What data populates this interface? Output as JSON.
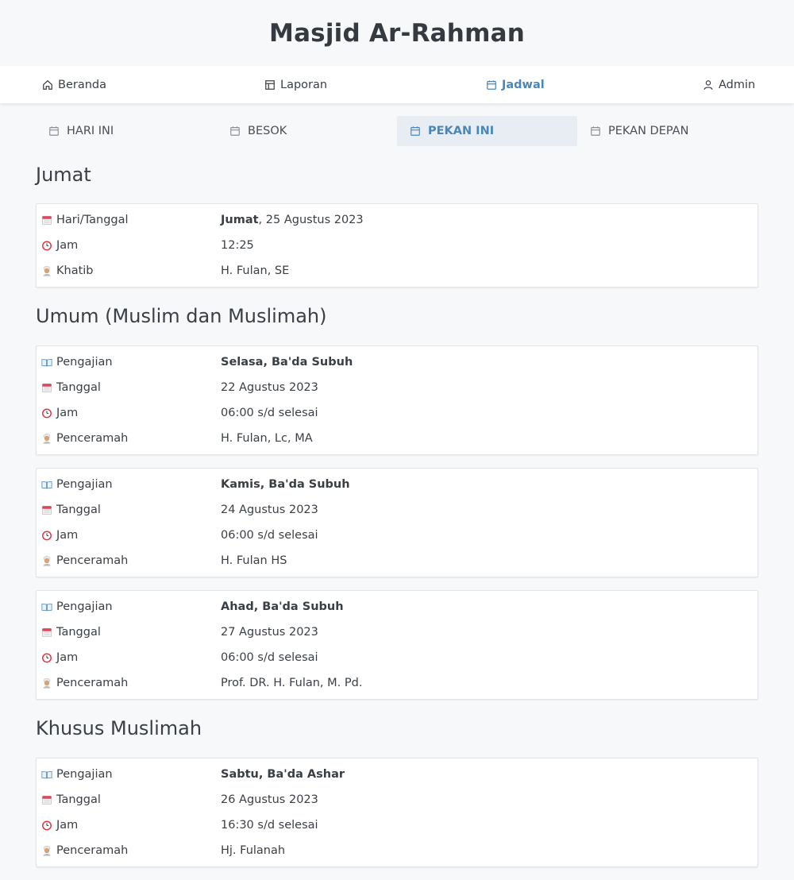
{
  "app": {
    "title": "Masjid Ar-Rahman"
  },
  "nav": {
    "items": [
      {
        "label": "Beranda",
        "icon": "home-icon"
      },
      {
        "label": "Laporan",
        "icon": "table-icon"
      },
      {
        "label": "Jadwal",
        "icon": "calendar-icon",
        "active": true
      },
      {
        "label": "Admin",
        "icon": "user-icon"
      }
    ]
  },
  "tabs": [
    {
      "label": "HARI INI",
      "icon": "calendar-icon"
    },
    {
      "label": "BESOK",
      "icon": "calendar-icon"
    },
    {
      "label": "PEKAN INI",
      "icon": "calendar-icon",
      "active": true
    },
    {
      "label": "PEKAN DEPAN",
      "icon": "calendar-icon"
    }
  ],
  "colors": {
    "accent": "#4a86b8",
    "active_tab_bg": "#e8edf4",
    "page_bg": "#f7f8fa"
  },
  "sections": {
    "jumat": {
      "title": "Jumat",
      "card": {
        "hari_label": "Hari/Tanggal",
        "hari_day": "Jumat",
        "hari_date": ", 25 Agustus 2023",
        "jam_label": "Jam",
        "jam_value": "12:25",
        "khatib_label": "Khatib",
        "khatib_value": "H. Fulan, SE"
      }
    },
    "umum": {
      "title": "Umum (Muslim dan Muslimah)",
      "cards": [
        {
          "pengajian_label": "Pengajian",
          "pengajian_value": "Selasa, Ba'da Subuh",
          "tanggal_label": "Tanggal",
          "tanggal_value": "22 Agustus 2023",
          "jam_label": "Jam",
          "jam_value": "06:00 s/d selesai",
          "penceramah_label": "Penceramah",
          "penceramah_value": "H. Fulan, Lc, MA"
        },
        {
          "pengajian_label": "Pengajian",
          "pengajian_value": "Kamis, Ba'da Subuh",
          "tanggal_label": "Tanggal",
          "tanggal_value": "24 Agustus 2023",
          "jam_label": "Jam",
          "jam_value": "06:00 s/d selesai",
          "penceramah_label": "Penceramah",
          "penceramah_value": "H. Fulan HS"
        },
        {
          "pengajian_label": "Pengajian",
          "pengajian_value": "Ahad, Ba'da Subuh",
          "tanggal_label": "Tanggal",
          "tanggal_value": "27 Agustus 2023",
          "jam_label": "Jam",
          "jam_value": "06:00 s/d selesai",
          "penceramah_label": "Penceramah",
          "penceramah_value": "Prof. DR. H. Fulan, M. Pd."
        }
      ]
    },
    "muslimah": {
      "title": "Khusus Muslimah",
      "cards": [
        {
          "pengajian_label": "Pengajian",
          "pengajian_value": "Sabtu, Ba'da Ashar",
          "tanggal_label": "Tanggal",
          "tanggal_value": "26 Agustus 2023",
          "jam_label": "Jam",
          "jam_value": "16:30 s/d selesai",
          "penceramah_label": "Penceramah",
          "penceramah_value": "Hj. Fulanah"
        }
      ]
    }
  }
}
